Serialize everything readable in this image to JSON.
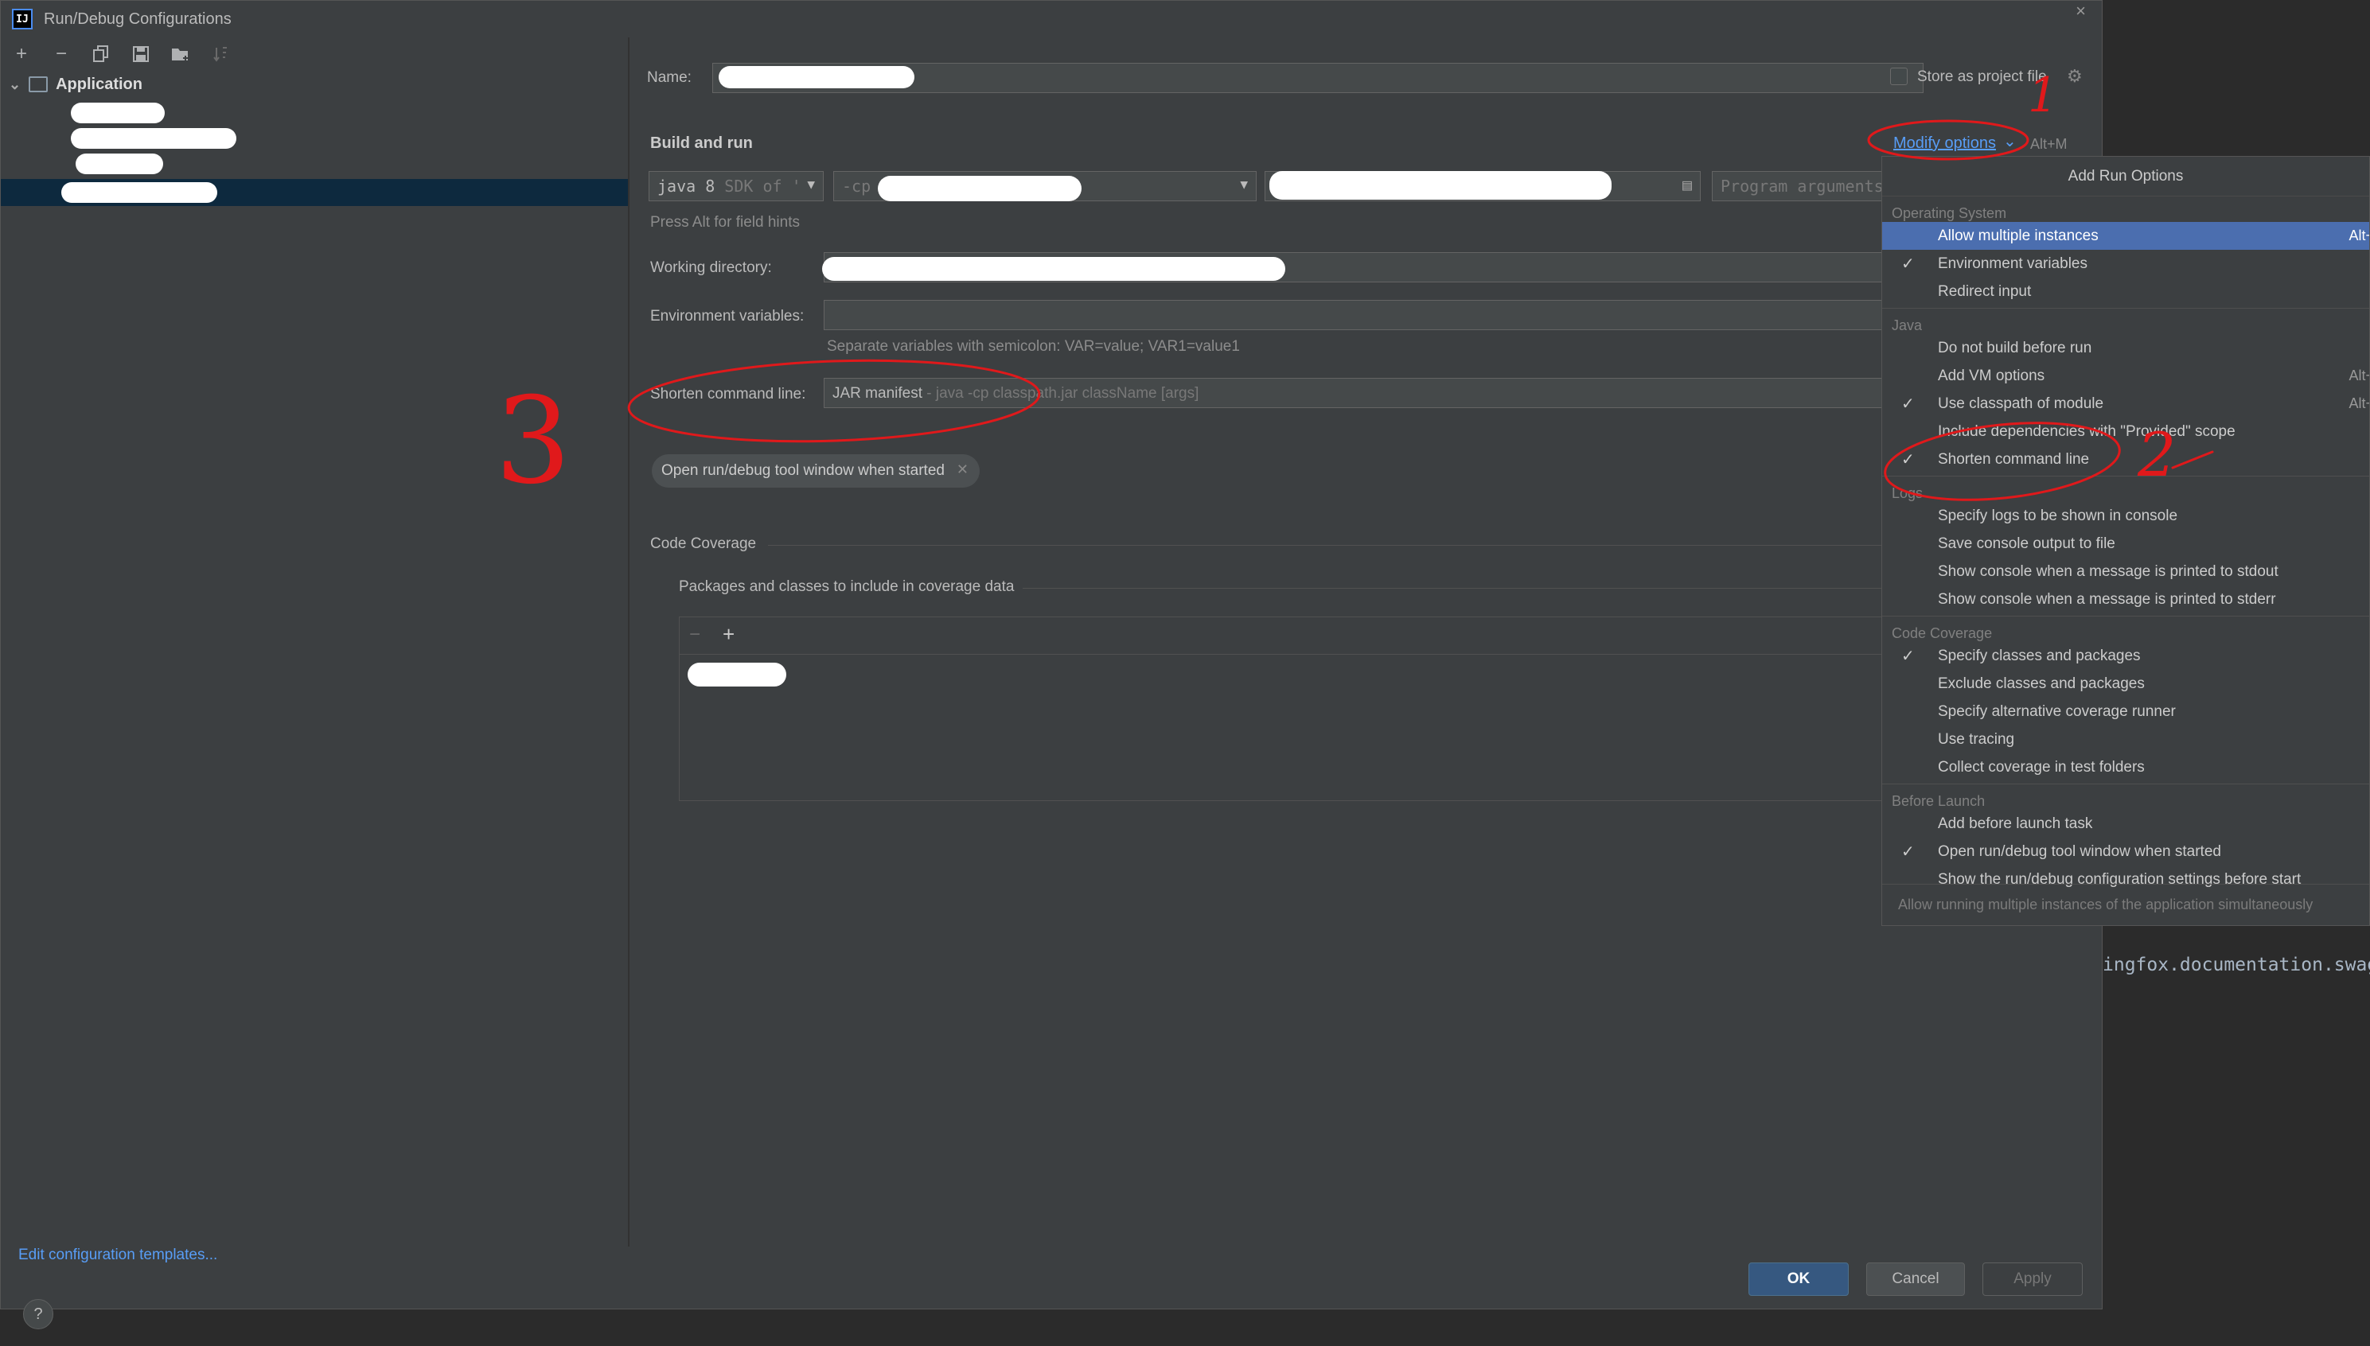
{
  "window": {
    "title": "Run/Debug Configurations",
    "app_icon": "IJ"
  },
  "left": {
    "toolbar": [
      "plus-icon",
      "minus-icon",
      "copy-icon",
      "save-icon",
      "folder-icon",
      "sort-icon"
    ],
    "root": "Application",
    "edit_templates": "Edit configuration templates..."
  },
  "form": {
    "name_label": "Name:",
    "store_label": "Store as project file",
    "build_and_run": "Build and run",
    "modify_options": "Modify options",
    "modify_shortcut": "Alt+M",
    "sdk_value": "java 8",
    "sdk_hint": "SDK of '",
    "cp_value": "-cp",
    "program_args_placeholder": "Program arguments",
    "alt_hint": "Press Alt for field hints",
    "working_dir_label": "Working directory:",
    "env_label": "Environment variables:",
    "env_hint": "Separate variables with semicolon: VAR=value; VAR1=value1",
    "shorten_label": "Shorten command line:",
    "shorten_value": "JAR manifest",
    "shorten_hint": "- java -cp classpath.jar className [args]",
    "open_tool_chip": "Open run/debug tool window when started",
    "code_coverage": "Code Coverage",
    "packages_label": "Packages and classes to include in coverage data"
  },
  "buttons": {
    "ok": "OK",
    "cancel": "Cancel",
    "apply": "Apply",
    "help": "?"
  },
  "popup": {
    "title": "Add Run Options",
    "groups": [
      {
        "header": "Operating System",
        "items": [
          {
            "label": "Allow multiple instances",
            "shortcut": "Alt+",
            "checked": false,
            "selected": true
          },
          {
            "label": "Environment variables",
            "shortcut": "",
            "checked": true,
            "selected": false
          },
          {
            "label": "Redirect input",
            "shortcut": "",
            "checked": false,
            "selected": false
          }
        ]
      },
      {
        "header": "Java",
        "items": [
          {
            "label": "Do not build before run",
            "shortcut": "",
            "checked": false,
            "selected": false
          },
          {
            "label": "Add VM options",
            "shortcut": "Alt+",
            "checked": false,
            "selected": false
          },
          {
            "label": "Use classpath of module",
            "shortcut": "Alt+",
            "checked": true,
            "selected": false
          },
          {
            "label": "Include dependencies with \"Provided\" scope",
            "shortcut": "",
            "checked": false,
            "selected": false
          },
          {
            "label": "Shorten command line",
            "shortcut": "",
            "checked": true,
            "selected": false
          }
        ]
      },
      {
        "header": "Logs",
        "items": [
          {
            "label": "Specify logs to be shown in console",
            "shortcut": "",
            "checked": false,
            "selected": false
          },
          {
            "label": "Save console output to file",
            "shortcut": "",
            "checked": false,
            "selected": false
          },
          {
            "label": "Show console when a message is printed to stdout",
            "shortcut": "",
            "checked": false,
            "selected": false
          },
          {
            "label": "Show console when a message is printed to stderr",
            "shortcut": "",
            "checked": false,
            "selected": false
          }
        ]
      },
      {
        "header": "Code Coverage",
        "items": [
          {
            "label": "Specify classes and packages",
            "shortcut": "",
            "checked": true,
            "selected": false
          },
          {
            "label": "Exclude classes and packages",
            "shortcut": "",
            "checked": false,
            "selected": false
          },
          {
            "label": "Specify alternative coverage runner",
            "shortcut": "",
            "checked": false,
            "selected": false
          },
          {
            "label": "Use tracing",
            "shortcut": "",
            "checked": false,
            "selected": false
          },
          {
            "label": "Collect coverage in test folders",
            "shortcut": "",
            "checked": false,
            "selected": false
          }
        ]
      },
      {
        "header": "Before Launch",
        "items": [
          {
            "label": "Add before launch task",
            "shortcut": "",
            "checked": false,
            "selected": false
          },
          {
            "label": "Open run/debug tool window when started",
            "shortcut": "",
            "checked": true,
            "selected": false
          },
          {
            "label": "Show the run/debug configuration settings before start",
            "shortcut": "",
            "checked": false,
            "selected": false
          }
        ]
      }
    ],
    "footer": "Allow running multiple instances of the application simultaneously"
  },
  "editor_line": "ingfox.documentation.swagg",
  "annotations": {
    "n1": "1",
    "n2": "2",
    "n3": "3",
    "color": "#e0191b"
  }
}
